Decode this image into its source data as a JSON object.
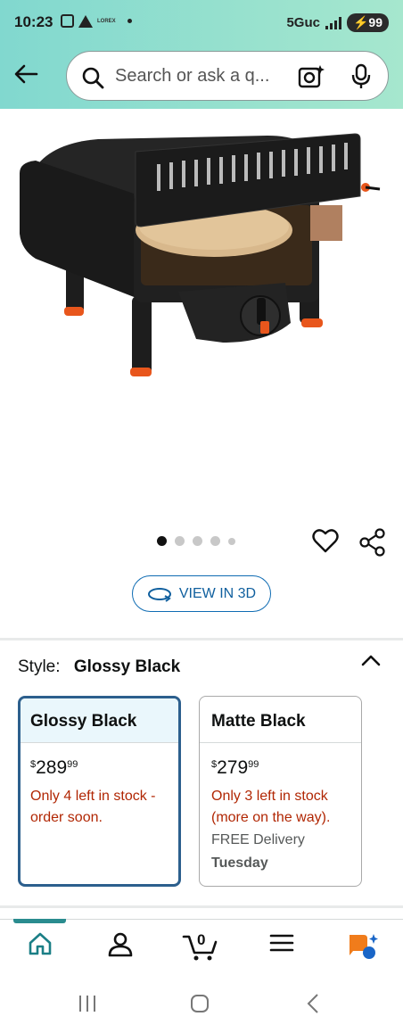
{
  "status_bar": {
    "time": "10:23",
    "small_tag": "LOREX",
    "network": "5Guc",
    "battery": "99"
  },
  "search": {
    "placeholder": "Search or ask a q..."
  },
  "gallery": {
    "dots_total": 5,
    "active_dot": 0
  },
  "view_3d": {
    "label": "VIEW IN 3D"
  },
  "style_selector": {
    "label": "Style:",
    "selected_value": "Glossy Black",
    "options": [
      {
        "name": "Glossy Black",
        "currency": "$",
        "price_whole": "289",
        "price_fraction": "99",
        "stock_text": "Only 4 left in stock - order soon.",
        "delivery_text": "",
        "delivery_day": ""
      },
      {
        "name": "Matte Black",
        "currency": "$",
        "price_whole": "279",
        "price_fraction": "99",
        "stock_text": "Only 3 left in stock (more on the way).",
        "delivery_text": "FREE Delivery",
        "delivery_day": "Tuesday"
      }
    ]
  },
  "bottom_nav": {
    "items": [
      "home-icon",
      "account-icon",
      "cart-icon",
      "menu-icon",
      "rufus-icon"
    ],
    "cart_count": "0",
    "accent_color": "#2a8c8f"
  },
  "colors": {
    "header_gradient_start": "#81d8cf",
    "header_gradient_end": "#a6e7ce",
    "price_stock_red": "#b12704",
    "link_blue": "#0f5f9e",
    "selected_border": "#2c5f8d"
  }
}
